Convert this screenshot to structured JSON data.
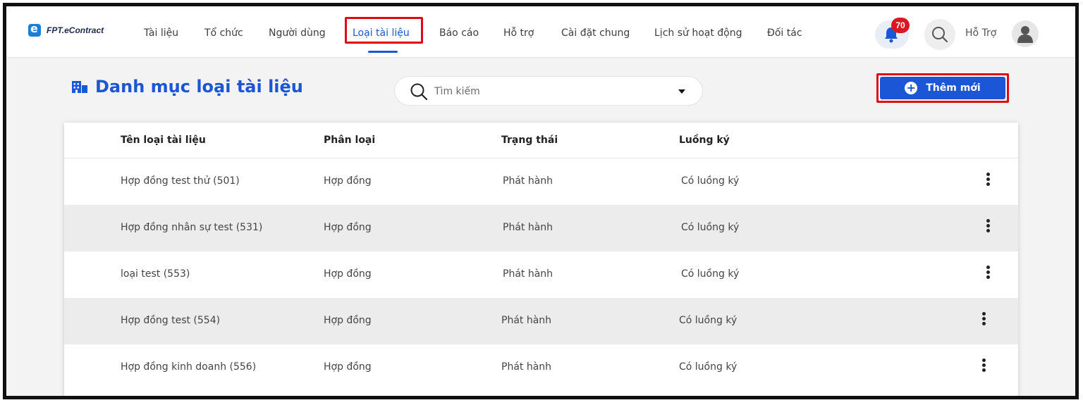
{
  "brand": {
    "name": "FPT.eContract"
  },
  "nav": {
    "items": [
      {
        "label": "Tài liệu"
      },
      {
        "label": "Tổ chức"
      },
      {
        "label": "Người dùng"
      },
      {
        "label": "Loại tài liệu",
        "active": true
      },
      {
        "label": "Báo cáo"
      },
      {
        "label": "Hỗ trợ"
      },
      {
        "label": "Cài đặt chung"
      },
      {
        "label": "Lịch sử hoạt động"
      },
      {
        "label": "Đối tác"
      }
    ]
  },
  "header_right": {
    "notification_count": "70",
    "user_name": "Hỗ Trợ"
  },
  "page": {
    "title": "Danh mục loại tài liệu",
    "search_placeholder": "Tìm kiếm",
    "add_button_label": "Thêm mới"
  },
  "table": {
    "columns": [
      "Tên loại tài liệu",
      "Phân loại",
      "Trạng thái",
      "Luồng ký"
    ],
    "rows": [
      {
        "name": "Hợp đồng test thử  (501)",
        "type": "Hợp đồng",
        "status": "Phát hành",
        "flow": "Có luồng ký"
      },
      {
        "name": "Hợp đồng nhân sự test  (531)",
        "type": "Hợp đồng",
        "status": "Phát hành",
        "flow": "Có luồng ký"
      },
      {
        "name": "loại test  (553)",
        "type": "Hợp đồng",
        "status": "Phát hành",
        "flow": "Có luồng ký"
      },
      {
        "name": "Hợp đồng test  (554)",
        "type": "Hợp đồng",
        "status": "Phát hành",
        "flow": "Có luồng ký"
      },
      {
        "name": "Hợp đồng kinh doanh  (556)",
        "type": "Hợp đồng",
        "status": "Phát hành",
        "flow": "Có luồng ký"
      }
    ]
  },
  "colors": {
    "accent": "#1a56d6",
    "highlight_border": "#e30613",
    "badge": "#d71921",
    "row_alt": "#ececec"
  }
}
